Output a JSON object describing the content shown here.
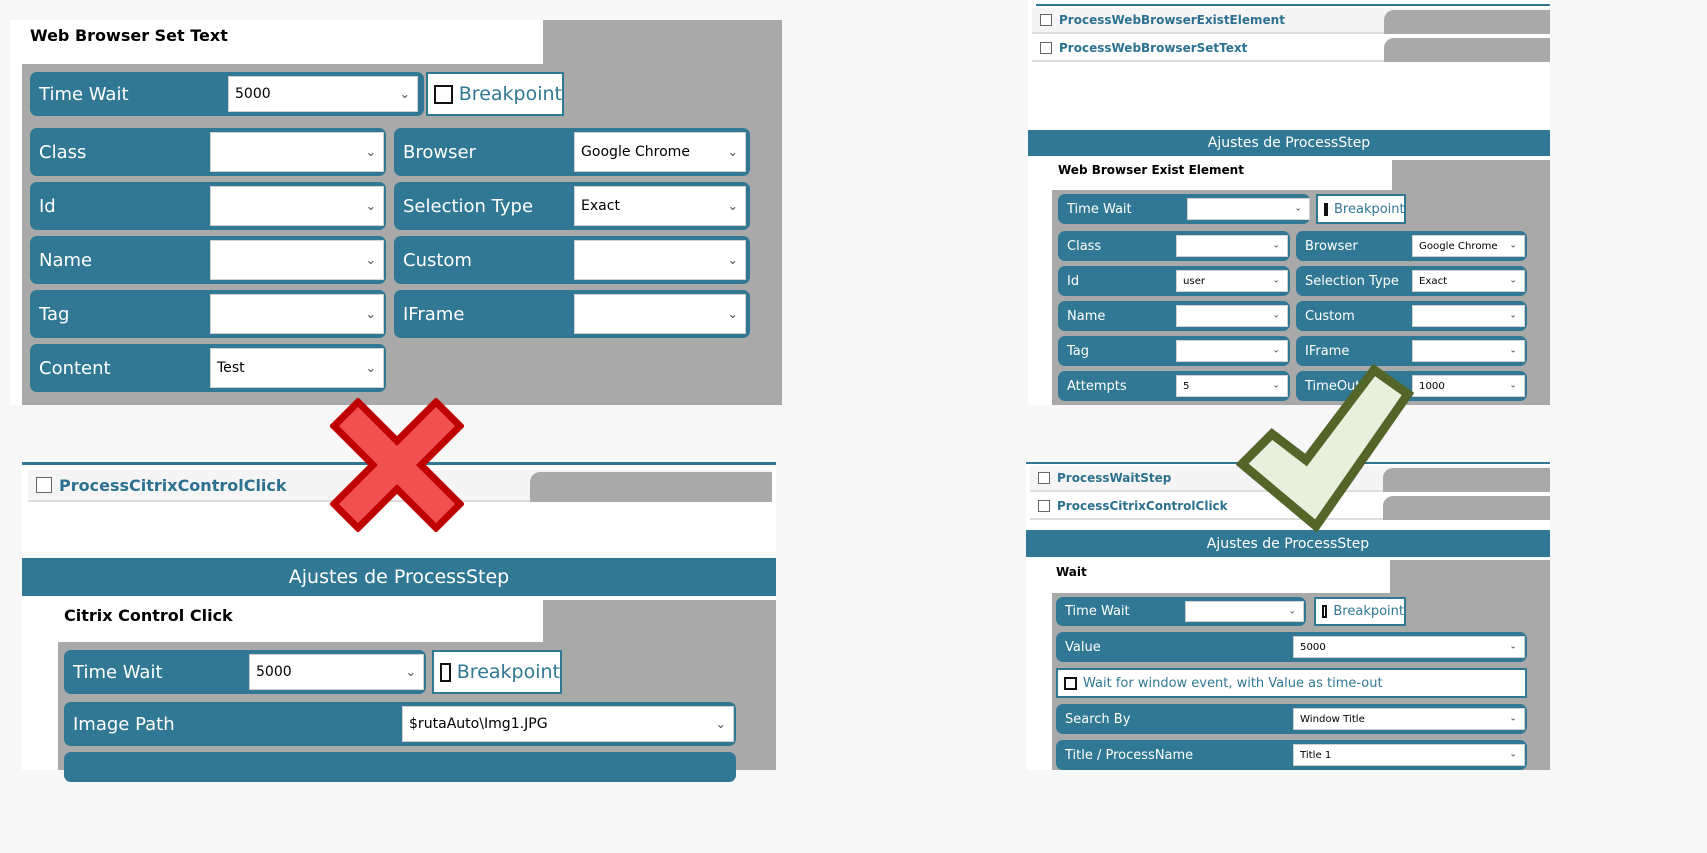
{
  "panel_a": {
    "title": "Web Browser Set Text",
    "time_wait": {
      "label": "Time Wait",
      "value": "5000"
    },
    "breakpoint": "Breakpoint",
    "fields": [
      {
        "label": "Class",
        "value": ""
      },
      {
        "label": "Browser",
        "value": "Google Chrome"
      },
      {
        "label": "Id",
        "value": ""
      },
      {
        "label": "Selection Type",
        "value": "Exact"
      },
      {
        "label": "Name",
        "value": ""
      },
      {
        "label": "Custom",
        "value": ""
      },
      {
        "label": "Tag",
        "value": ""
      },
      {
        "label": "IFrame",
        "value": ""
      },
      {
        "label": "Content",
        "value": "Test"
      }
    ]
  },
  "panel_b": {
    "list": [
      "ProcessCitrixControlClick"
    ],
    "header": "Ajustes de ProcessStep",
    "title": "Citrix Control Click",
    "time_wait": {
      "label": "Time Wait",
      "value": "5000"
    },
    "breakpoint": "Breakpoint",
    "fields": [
      {
        "label": "Image Path",
        "value": "$rutaAuto\\Img1.JPG"
      }
    ]
  },
  "panel_c": {
    "list": [
      "ProcessWebBrowserExistElement",
      "ProcessWebBrowserSetText"
    ],
    "header": "Ajustes de ProcessStep",
    "title": "Web Browser Exist Element",
    "time_wait": {
      "label": "Time Wait",
      "value": ""
    },
    "breakpoint": "Breakpoint",
    "fields": [
      {
        "label": "Class",
        "value": ""
      },
      {
        "label": "Browser",
        "value": "Google Chrome"
      },
      {
        "label": "Id",
        "value": "user"
      },
      {
        "label": "Selection Type",
        "value": "Exact"
      },
      {
        "label": "Name",
        "value": ""
      },
      {
        "label": "Custom",
        "value": ""
      },
      {
        "label": "Tag",
        "value": ""
      },
      {
        "label": "IFrame",
        "value": ""
      },
      {
        "label": "Attempts",
        "value": "5"
      },
      {
        "label": "TimeOut",
        "value": "1000"
      }
    ]
  },
  "panel_d": {
    "list": [
      "ProcessWaitStep",
      "ProcessCitrixControlClick"
    ],
    "header": "Ajustes de ProcessStep",
    "title": "Wait",
    "time_wait": {
      "label": "Time Wait",
      "value": ""
    },
    "breakpoint": "Breakpoint",
    "fields": [
      {
        "label": "Value",
        "value": "5000"
      },
      {
        "label": "Search By",
        "value": "Window Title"
      },
      {
        "label": "Title / ProcessName",
        "value": "Title 1"
      }
    ],
    "wait_event": "Wait for window event, with Value as time-out"
  },
  "icons": {
    "wrong": "red-x-icon",
    "right": "green-check-icon"
  },
  "colors": {
    "teal": "#307893",
    "gray": "#a9a9a9",
    "red": "#f05050",
    "green": "#536528"
  }
}
